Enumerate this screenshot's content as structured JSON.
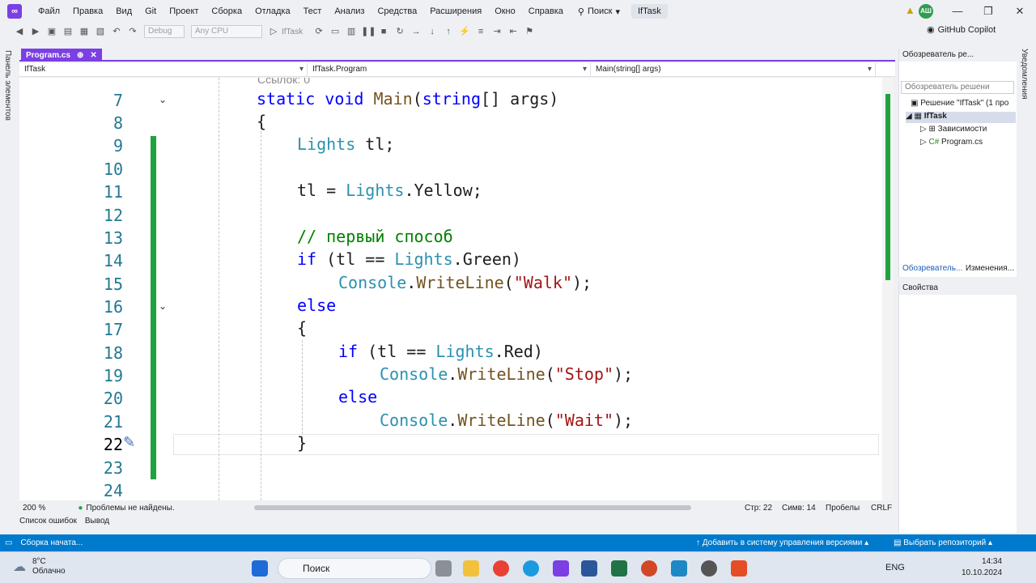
{
  "menu": {
    "items": [
      "Файл",
      "Правка",
      "Вид",
      "Git",
      "Проект",
      "Сборка",
      "Отладка",
      "Тест",
      "Анализ",
      "Средства",
      "Расширения",
      "Окно",
      "Справка"
    ],
    "search": "Поиск",
    "solution_name": "IfTask",
    "avatar": "АШ"
  },
  "toolbar": {
    "config": "Debug",
    "platform": "Any CPU",
    "run_target": "IfTask",
    "copilot": "GitHub Copilot"
  },
  "left_strip": "Панель элементов",
  "right_strip": "Уведомления",
  "editor": {
    "tab": "Program.cs",
    "nav": [
      "IfTask",
      "IfTask.Program",
      "Main(string[] args)"
    ],
    "refs_hint": "Ссылок: 0",
    "zoom": "200 %",
    "issues": "Проблемы не найдены.",
    "position": {
      "line": "Стр: 22",
      "col": "Симв: 14",
      "whitespace": "Пробелы",
      "eol": "CRLF"
    }
  },
  "code": {
    "lines": [
      {
        "n": "7"
      },
      {
        "n": "8"
      },
      {
        "n": "9"
      },
      {
        "n": "10"
      },
      {
        "n": "11"
      },
      {
        "n": "12"
      },
      {
        "n": "13"
      },
      {
        "n": "14"
      },
      {
        "n": "15"
      },
      {
        "n": "16"
      },
      {
        "n": "17"
      },
      {
        "n": "18"
      },
      {
        "n": "19"
      },
      {
        "n": "20"
      },
      {
        "n": "21"
      },
      {
        "n": "22"
      },
      {
        "n": "23"
      },
      {
        "n": "24"
      }
    ],
    "t": {
      "static": "static",
      "void": "void",
      "main": "Main",
      "string": "string",
      "brackets": "[] ",
      "args": "args",
      "close": ")",
      "lbrace": "{",
      "rbrace": "}",
      "lights": "Lights",
      "tl": " tl;",
      "tl_assign": "tl = ",
      "yellow": ".Yellow;",
      "comment": "// первый способ",
      "if": "if",
      "cond_open": " (tl == ",
      "green": ".Green)",
      "red": ".Red)",
      "console": "Console",
      "dot": ".",
      "writeline": "WriteLine",
      "lp": "(",
      "walk": "\"Walk\"",
      "stop": "\"Stop\"",
      "wait": "\"Wait\"",
      "rp": ");",
      "else": "else",
      "sp": " ",
      "paren": "("
    }
  },
  "bottom_tabs": [
    "Список ошибок",
    "Вывод"
  ],
  "solution_explorer": {
    "title": "Обозреватель ре...",
    "search": "Обозреватель решени",
    "solution": "Решение \"IfTask\" (1 про",
    "project": "IfTask",
    "deps": "Зависимости",
    "file": "Program.cs",
    "tab1": "Обозреватель...",
    "tab2": "Изменения..."
  },
  "properties": {
    "title": "Свойства"
  },
  "statusbar": {
    "left": "Сборка начата...",
    "vcs": "Добавить в систему управления версиями",
    "repo": "Выбрать репозиторий"
  },
  "taskbar": {
    "weather_temp": "8°C",
    "weather_desc": "Облачно",
    "search": "Поиск",
    "lang": "ENG",
    "time": "14:34",
    "date": "10.10.2024"
  },
  "colors": {
    "accent": "#7b3fe4",
    "status": "#007acc",
    "change": "#1fa33f",
    "keyword": "#0000ff",
    "type": "#2b91af",
    "string": "#a31515",
    "comment": "#008000"
  }
}
